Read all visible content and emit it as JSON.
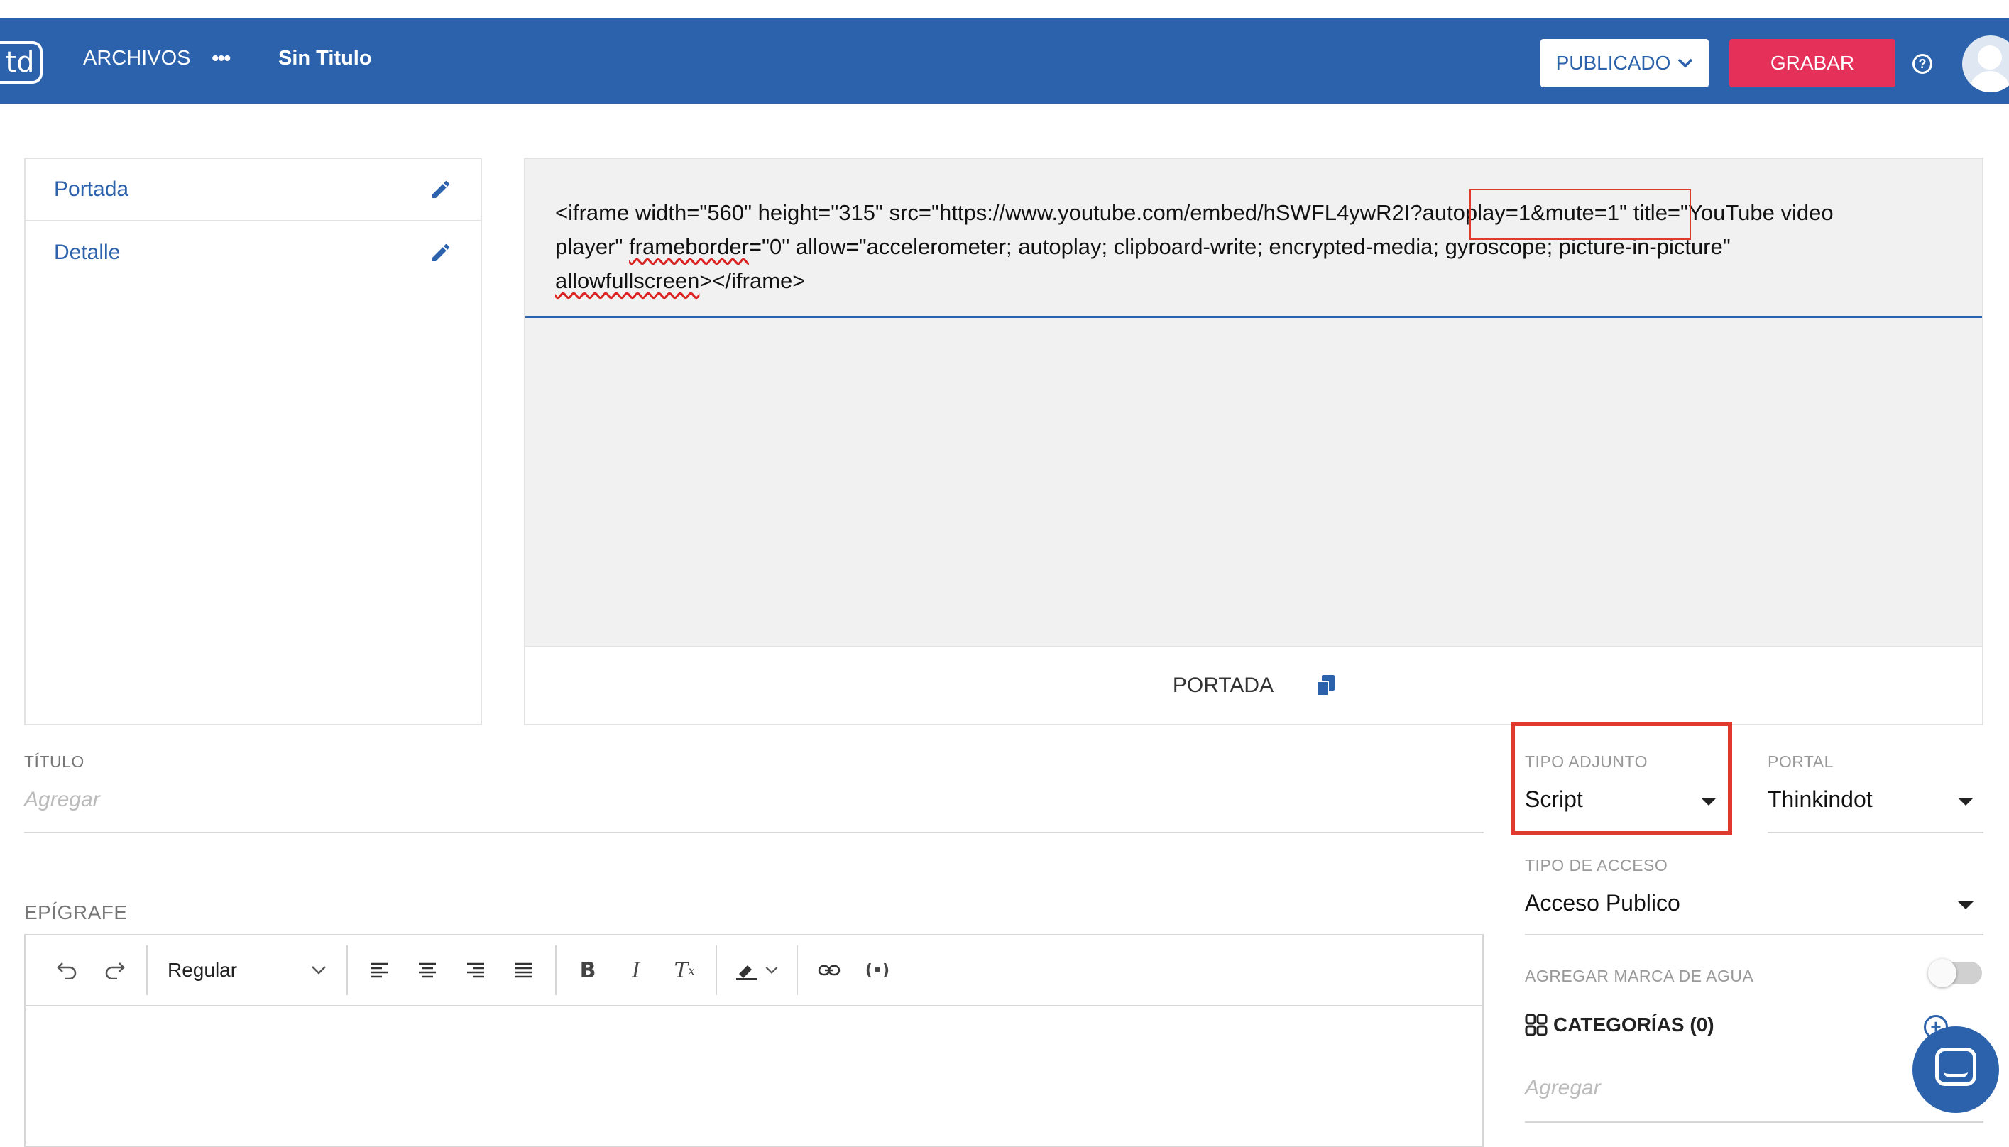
{
  "app": {
    "logo_text": "td",
    "menu_archivos": "ARCHIVOS",
    "more_dots": "•••",
    "doc_title": "Sin Titulo",
    "status_label": "PUBLICADO",
    "save_label": "GRABAR",
    "help_symbol": "?"
  },
  "sidebar": {
    "items": [
      {
        "label": "Portada"
      },
      {
        "label": "Detalle"
      }
    ]
  },
  "embed": {
    "line1_a": "<iframe width=\"560\" height=\"315\" src=\"https://www.youtube.com/embed/hSWFL4ywR2I",
    "line1_hl": "?autoplay=1&mute=1",
    "line1_b": "\" title=\"YouTube video",
    "line2_a": "player\" ",
    "line2_sq": "frameborder",
    "line2_b": "=\"0\" allow=\"accelerometer; autoplay; clipboard-write; encrypted-media; gyroscope; picture-in-picture\"",
    "line3_sq": "allowfullscreen",
    "line3_b": "></iframe>",
    "footer_label": "PORTADA"
  },
  "form": {
    "titulo_label": "TÍTULO",
    "titulo_placeholder": "Agregar",
    "epigrafe_label": "EPÍGRAFE",
    "tipo_adjunto_label": "TIPO ADJUNTO",
    "tipo_adjunto_value": "Script",
    "portal_label": "PORTAL",
    "portal_value": "Thinkindot",
    "tipo_acceso_label": "TIPO DE ACCESO",
    "tipo_acceso_value": "Acceso Publico",
    "marca_agua_label": "AGREGAR MARCA DE AGUA",
    "marca_agua_on": false,
    "categorias_label": "CATEGORÍAS (0)",
    "categorias_placeholder": "Agregar"
  },
  "editor": {
    "format_value": "Regular",
    "tools": [
      "undo-icon",
      "redo-icon",
      "align-left-icon",
      "align-center-icon",
      "align-right-icon",
      "align-justify-icon",
      "bold-icon",
      "italic-icon",
      "clear-format-icon",
      "highlight-icon",
      "link-icon",
      "embed-icon"
    ]
  },
  "colors": {
    "brand_blue": "#2b62ab",
    "save_red": "#e5315a",
    "annotation_red": "#e03a2e"
  }
}
